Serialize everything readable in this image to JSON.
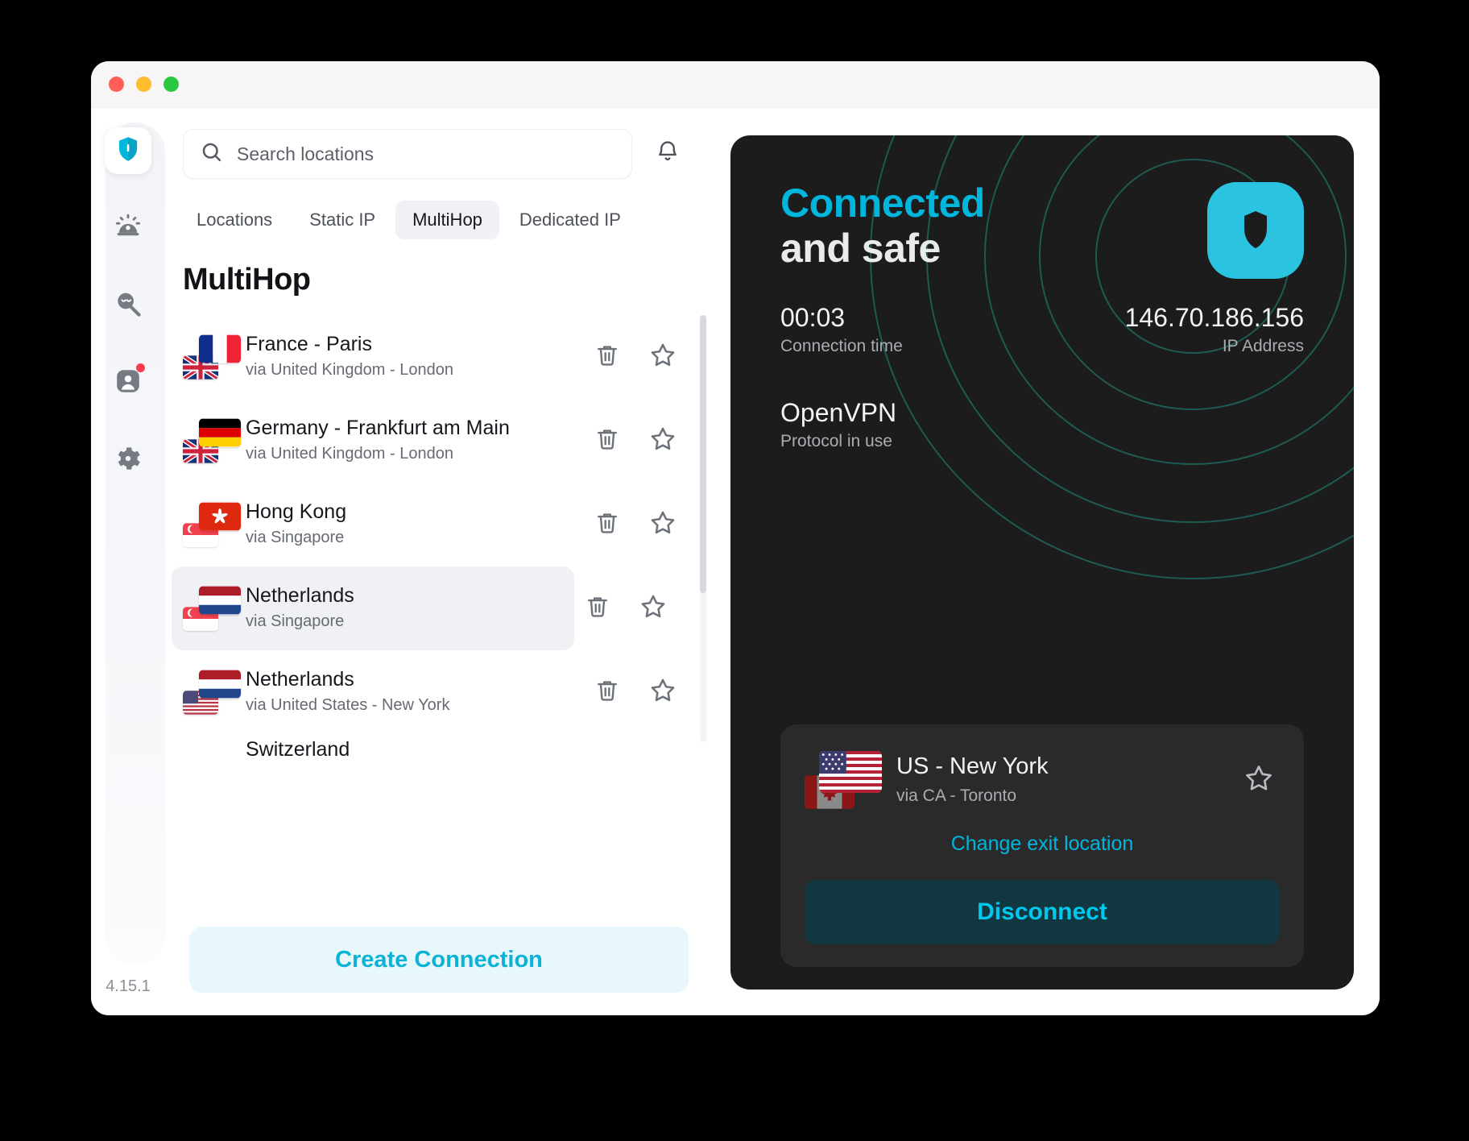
{
  "window": {
    "traffic_lights": [
      "close",
      "minimize",
      "maximize"
    ],
    "version": "4.15.1"
  },
  "rail": {
    "items": [
      {
        "icon": "shield-icon",
        "active": true
      },
      {
        "icon": "alarm-icon",
        "active": false
      },
      {
        "icon": "incognito-search-icon",
        "active": false
      },
      {
        "icon": "account-icon",
        "active": false,
        "badge": true
      },
      {
        "icon": "gear-icon",
        "active": false
      }
    ]
  },
  "search": {
    "placeholder": "Search locations",
    "icon": "search-icon",
    "bell_icon": "bell-icon"
  },
  "tabs": [
    {
      "label": "Locations",
      "active": false
    },
    {
      "label": "Static IP",
      "active": false
    },
    {
      "label": "MultiHop",
      "active": true
    },
    {
      "label": "Dedicated IP",
      "active": false
    }
  ],
  "list": {
    "title": "MultiHop",
    "rows": [
      {
        "title": "France - Paris",
        "subtitle": "via United Kingdom - London",
        "flag_main": "fr",
        "flag_sub": "gb",
        "selected": false,
        "delete_icon": "trash-icon",
        "favorite_icon": "star-outline-icon"
      },
      {
        "title": "Germany - Frankfurt am Main",
        "subtitle": "via United Kingdom - London",
        "flag_main": "de",
        "flag_sub": "gb",
        "selected": false,
        "delete_icon": "trash-icon",
        "favorite_icon": "star-outline-icon"
      },
      {
        "title": "Hong Kong",
        "subtitle": "via Singapore",
        "flag_main": "hk",
        "flag_sub": "sg",
        "selected": false,
        "delete_icon": "trash-icon",
        "favorite_icon": "star-outline-icon"
      },
      {
        "title": "Netherlands",
        "subtitle": "via Singapore",
        "flag_main": "nl",
        "flag_sub": "sg",
        "selected": true,
        "delete_icon": "trash-icon",
        "favorite_icon": "star-outline-icon"
      },
      {
        "title": "Netherlands",
        "subtitle": "via United States - New York",
        "flag_main": "nl",
        "flag_sub": "us",
        "selected": false,
        "delete_icon": "trash-icon",
        "favorite_icon": "star-outline-icon"
      }
    ],
    "partial_row_title": "Switzerland"
  },
  "create_button": {
    "label": "Create Connection"
  },
  "connection": {
    "status_line1": "Connected",
    "status_line2": "and safe",
    "time_value": "00:03",
    "time_label": "Connection time",
    "ip_value": "146.70.186.156",
    "ip_label": "IP Address",
    "protocol_value": "OpenVPN",
    "protocol_label": "Protocol in use",
    "logo_icon": "shield-logo-icon"
  },
  "exit_card": {
    "title": "US - New York",
    "subtitle": "via CA - Toronto",
    "flag_main": "us",
    "flag_sub": "ca",
    "favorite_icon": "star-outline-icon",
    "change_link": "Change exit location",
    "disconnect_label": "Disconnect"
  },
  "colors": {
    "accent": "#00b6dd",
    "accent_bright": "#00c7ec",
    "panel_bg": "#1c1c1c",
    "card_bg": "#2a2a2a",
    "disconnect_bg": "#113740",
    "create_bg": "#e7f7fb",
    "selected_row": "#f0f1f5"
  }
}
